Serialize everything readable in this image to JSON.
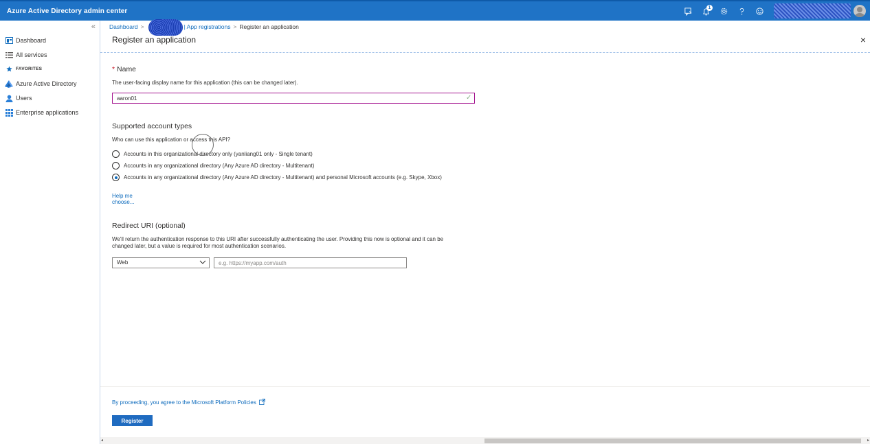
{
  "app": {
    "title": "Azure Active Directory admin center"
  },
  "topbar": {
    "icons": [
      "feedback-icon",
      "notifications-icon",
      "settings-icon",
      "help-icon",
      "smiley-icon"
    ],
    "notification_count": "1"
  },
  "sidebar": {
    "collapse_glyph": "«",
    "items": [
      {
        "label": "Dashboard",
        "icon": "dashboard-icon"
      },
      {
        "label": "All services",
        "icon": "list-icon"
      },
      {
        "label": "FAVORITES",
        "icon": "star-icon"
      },
      {
        "label": "Azure Active Directory",
        "icon": "aad-icon"
      },
      {
        "label": "Users",
        "icon": "user-icon"
      },
      {
        "label": "Enterprise applications",
        "icon": "apps-icon"
      }
    ]
  },
  "breadcrumb": {
    "items": [
      "Dashboard",
      "| App registrations",
      "Register an application"
    ],
    "separator": ">"
  },
  "blade": {
    "title": "Register an application",
    "close_glyph": "×"
  },
  "form": {
    "name": {
      "required_marker": "*",
      "label": "Name",
      "description": "The user-facing display name for this application (this can be changed later).",
      "value": "aaron01"
    },
    "account_types": {
      "heading": "Supported account types",
      "question": "Who can use this application or access this API?",
      "options": [
        {
          "label": "Accounts in this organizational directory only (yanliang01 only - Single tenant)",
          "selected": false
        },
        {
          "label": "Accounts in any organizational directory (Any Azure AD directory - Multitenant)",
          "selected": false
        },
        {
          "label": "Accounts in any organizational directory (Any Azure AD directory - Multitenant) and personal Microsoft accounts (e.g. Skype, Xbox)",
          "selected": true
        }
      ],
      "help_link": "Help me choose..."
    },
    "redirect": {
      "heading": "Redirect URI (optional)",
      "description_line1": "We'll return the authentication response to this URI after successfully authenticating the user. Providing this now is optional and it can be",
      "description_line2": "changed later, but a value is required for most authentication scenarios.",
      "platform_value": "Web",
      "uri_placeholder": "e.g. https://myapp.com/auth"
    }
  },
  "footer": {
    "policy_text": "By proceeding, you agree to the Microsoft Platform Policies",
    "register_label": "Register"
  },
  "colors": {
    "topbar": "#1f73c6",
    "link": "#0f6cbd",
    "focus_border": "#a4138f",
    "primary_button": "#1f6bc0"
  }
}
